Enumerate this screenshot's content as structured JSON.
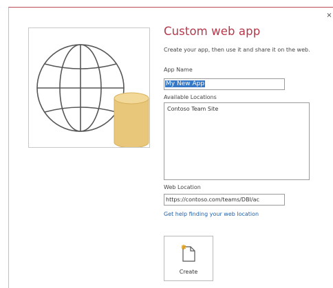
{
  "dialog": {
    "close_glyph": "×",
    "title": "Custom web app",
    "description": "Create your app, then use it and share it on the web.",
    "app_name": {
      "label": "App Name",
      "value": "My New App"
    },
    "available_locations": {
      "label": "Available Locations",
      "items": [
        "Contoso Team Site"
      ]
    },
    "web_location": {
      "label": "Web Location",
      "value": "https://contoso.com/teams/DBI/ac"
    },
    "help_link": "Get help finding your web location",
    "create_button": {
      "label": "Create",
      "icon": "new-document-icon"
    },
    "preview_icon": "globe-database-icon"
  },
  "colors": {
    "title": "#b5384a",
    "link": "#1f5fa8",
    "selection": "#3578c8",
    "database": "#e8c77a"
  }
}
